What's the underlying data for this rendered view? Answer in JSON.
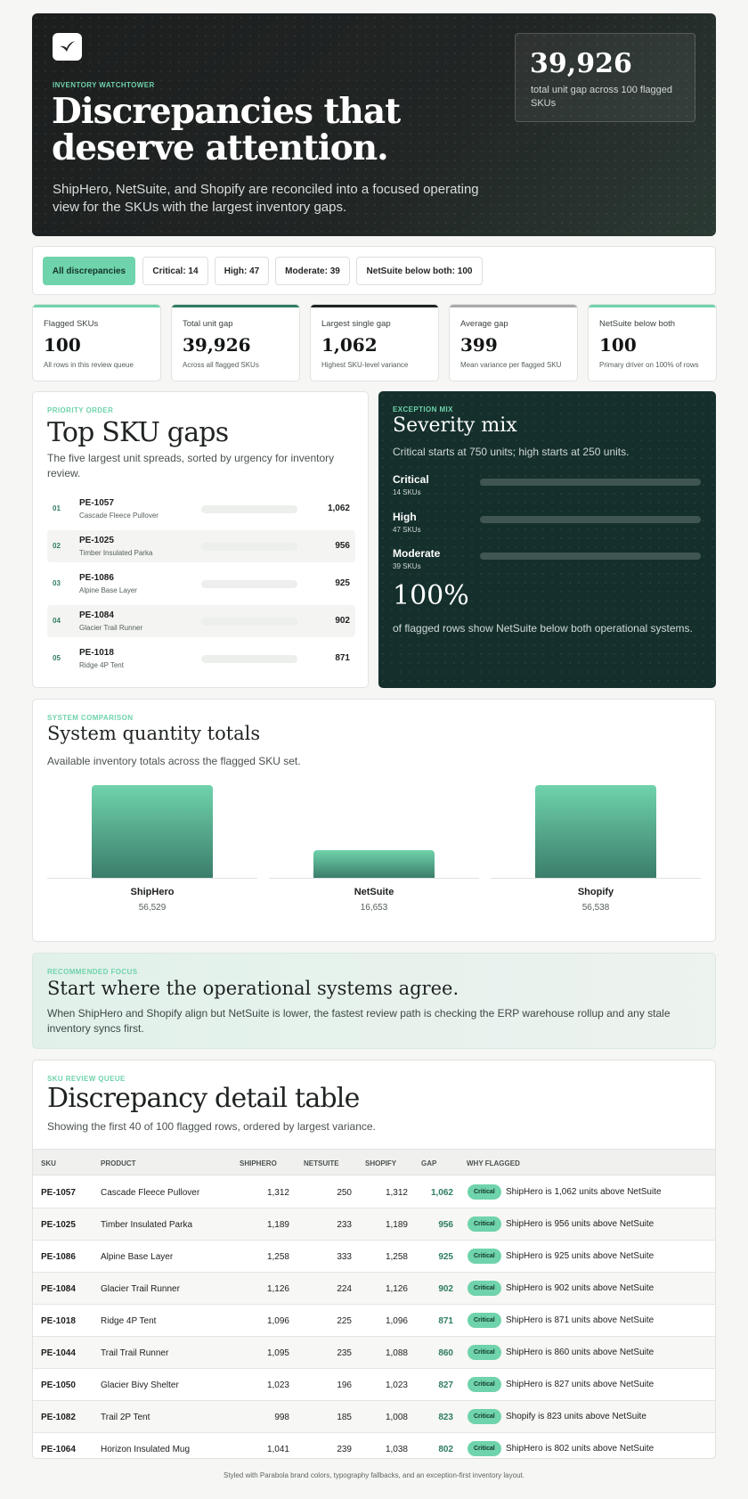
{
  "hero": {
    "eyebrow": "INVENTORY WATCHTOWER",
    "title": "Discrepancies that deserve attention.",
    "lede": "ShipHero, NetSuite, and Shopify are reconciled into a focused operating view for the SKUs with the largest inventory gaps.",
    "stat_value": "39,926",
    "stat_label": "total unit gap across 100 flagged SKUs"
  },
  "filters": [
    "All discrepancies",
    "Critical: 14",
    "High: 47",
    "Moderate: 39",
    "NetSuite below both: 100"
  ],
  "kpis": [
    {
      "label": "Flagged SKUs",
      "value": "100",
      "sub": "All rows in this review queue",
      "color": "#6fd3ab"
    },
    {
      "label": "Total unit gap",
      "value": "39,926",
      "sub": "Across all flagged SKUs",
      "color": "#2f7d63"
    },
    {
      "label": "Largest single gap",
      "value": "1,062",
      "sub": "Highest SKU-level variance",
      "color": "#1f2322"
    },
    {
      "label": "Average gap",
      "value": "399",
      "sub": "Mean variance per flagged SKU",
      "color": "#a7aaa8"
    },
    {
      "label": "NetSuite below both",
      "value": "100",
      "sub": "Primary driver on 100% of rows",
      "color": "#6fd3ab"
    }
  ],
  "top": {
    "eyebrow": "PRIORITY ORDER",
    "title": "Top SKU gaps",
    "desc": "The five largest unit spreads, sorted by urgency for inventory review.",
    "max": 1062,
    "items": [
      {
        "rank": "01",
        "sku": "PE-1057",
        "name": "Cascade Fleece Pullover",
        "gap": 1062,
        "gap_text": "1,062"
      },
      {
        "rank": "02",
        "sku": "PE-1025",
        "name": "Timber Insulated Parka",
        "gap": 956,
        "gap_text": "956"
      },
      {
        "rank": "03",
        "sku": "PE-1086",
        "name": "Alpine Base Layer",
        "gap": 925,
        "gap_text": "925"
      },
      {
        "rank": "04",
        "sku": "PE-1084",
        "name": "Glacier Trail Runner",
        "gap": 902,
        "gap_text": "902"
      },
      {
        "rank": "05",
        "sku": "PE-1018",
        "name": "Ridge 4P Tent",
        "gap": 871,
        "gap_text": "871"
      }
    ]
  },
  "severity": {
    "eyebrow": "EXCEPTION MIX",
    "title": "Severity mix",
    "desc": "Critical starts at 750 units; high starts at 250 units.",
    "rows": [
      {
        "name": "Critical",
        "count_text": "14 SKUs",
        "share": 0.14,
        "color": "#6fd3ab"
      },
      {
        "name": "High",
        "count_text": "47 SKUs",
        "share": 0.47,
        "color": "#2f7d63"
      },
      {
        "name": "Moderate",
        "count_text": "39 SKUs",
        "share": 0.39,
        "color": "#2f7d63"
      }
    ],
    "big": "100%",
    "big_label": "of flagged rows show NetSuite below both operational systems."
  },
  "systems": {
    "eyebrow": "SYSTEM COMPARISON",
    "title": "System quantity totals",
    "desc": "Available inventory totals across the flagged SKU set.",
    "items": [
      {
        "name": "ShipHero",
        "value": 56529,
        "value_text": "56,529"
      },
      {
        "name": "NetSuite",
        "value": 16653,
        "value_text": "16,653"
      },
      {
        "name": "Shopify",
        "value": 56538,
        "value_text": "56,538"
      }
    ]
  },
  "recommended": {
    "eyebrow": "RECOMMENDED FOCUS",
    "title": "Start where the operational systems agree.",
    "desc": "When ShipHero and Shopify align but NetSuite is lower, the fastest review path is checking the ERP warehouse rollup and any stale inventory syncs first."
  },
  "table": {
    "eyebrow": "SKU REVIEW QUEUE",
    "title": "Discrepancy detail table",
    "desc": "Showing the first 40 of 100 flagged rows, ordered by largest variance.",
    "headers": [
      "SKU",
      "PRODUCT",
      "SHIPHERO",
      "NETSUITE",
      "SHOPIFY",
      "GAP",
      "WHY FLAGGED"
    ],
    "rows": [
      {
        "sku": "PE-1057",
        "product": "Cascade Fleece Pullover",
        "shiphero": "1,312",
        "netsuite": "250",
        "shopify": "1,312",
        "gap": "1,062",
        "severity": "Critical",
        "why": "ShipHero is 1,062 units above NetSuite"
      },
      {
        "sku": "PE-1025",
        "product": "Timber Insulated Parka",
        "shiphero": "1,189",
        "netsuite": "233",
        "shopify": "1,189",
        "gap": "956",
        "severity": "Critical",
        "why": "ShipHero is 956 units above NetSuite"
      },
      {
        "sku": "PE-1086",
        "product": "Alpine Base Layer",
        "shiphero": "1,258",
        "netsuite": "333",
        "shopify": "1,258",
        "gap": "925",
        "severity": "Critical",
        "why": "ShipHero is 925 units above NetSuite"
      },
      {
        "sku": "PE-1084",
        "product": "Glacier Trail Runner",
        "shiphero": "1,126",
        "netsuite": "224",
        "shopify": "1,126",
        "gap": "902",
        "severity": "Critical",
        "why": "ShipHero is 902 units above NetSuite"
      },
      {
        "sku": "PE-1018",
        "product": "Ridge 4P Tent",
        "shiphero": "1,096",
        "netsuite": "225",
        "shopify": "1,096",
        "gap": "871",
        "severity": "Critical",
        "why": "ShipHero is 871 units above NetSuite"
      },
      {
        "sku": "PE-1044",
        "product": "Trail Trail Runner",
        "shiphero": "1,095",
        "netsuite": "235",
        "shopify": "1,088",
        "gap": "860",
        "severity": "Critical",
        "why": "ShipHero is 860 units above NetSuite"
      },
      {
        "sku": "PE-1050",
        "product": "Glacier Bivy Shelter",
        "shiphero": "1,023",
        "netsuite": "196",
        "shopify": "1,023",
        "gap": "827",
        "severity": "Critical",
        "why": "ShipHero is 827 units above NetSuite"
      },
      {
        "sku": "PE-1082",
        "product": "Trail 2P Tent",
        "shiphero": "998",
        "netsuite": "185",
        "shopify": "1,008",
        "gap": "823",
        "severity": "Critical",
        "why": "Shopify is 823 units above NetSuite"
      },
      {
        "sku": "PE-1064",
        "product": "Horizon Insulated Mug",
        "shiphero": "1,041",
        "netsuite": "239",
        "shopify": "1,038",
        "gap": "802",
        "severity": "Critical",
        "why": "ShipHero is 802 units above NetSuite"
      }
    ]
  },
  "footer": "Styled with Parabola brand colors, typography fallbacks, and an exception-first inventory layout."
}
